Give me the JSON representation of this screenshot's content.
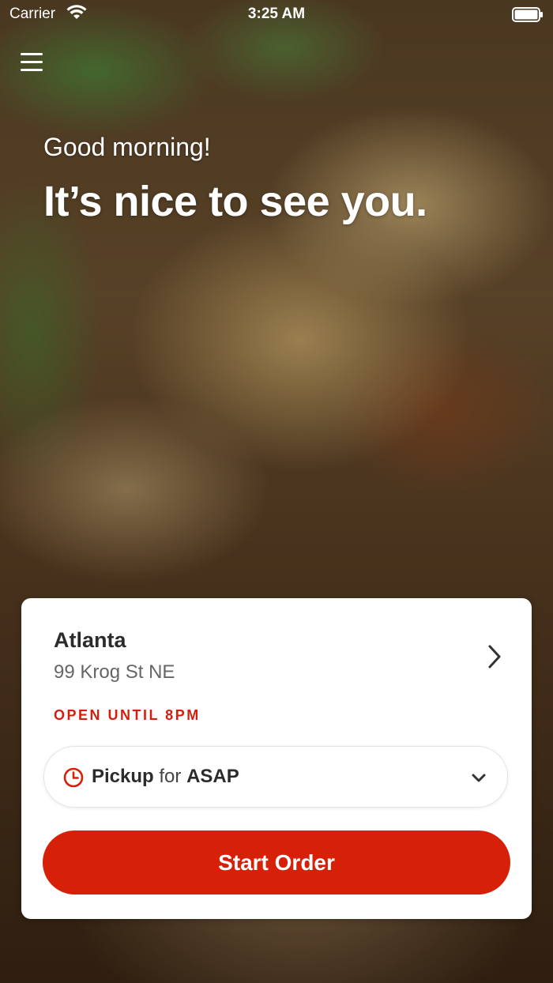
{
  "status_bar": {
    "carrier": "Carrier",
    "time": "3:25 AM"
  },
  "icons": {
    "menu": "hamburger-menu-icon",
    "wifi": "wifi-icon",
    "battery": "battery-icon",
    "chevron_right": "chevron-right-icon",
    "clock": "clock-icon",
    "chevron_down": "chevron-down-icon"
  },
  "hero": {
    "greeting": "Good morning!",
    "headline": "It’s nice to see you."
  },
  "location": {
    "city": "Atlanta",
    "address": "99 Krog St NE",
    "hours": "OPEN UNTIL 8PM"
  },
  "order_mode": {
    "mode": "Pickup",
    "connector": "for",
    "time": "ASAP"
  },
  "actions": {
    "start_order": "Start Order"
  },
  "colors": {
    "accent": "#d62008",
    "status_text": "#d41f0f"
  }
}
